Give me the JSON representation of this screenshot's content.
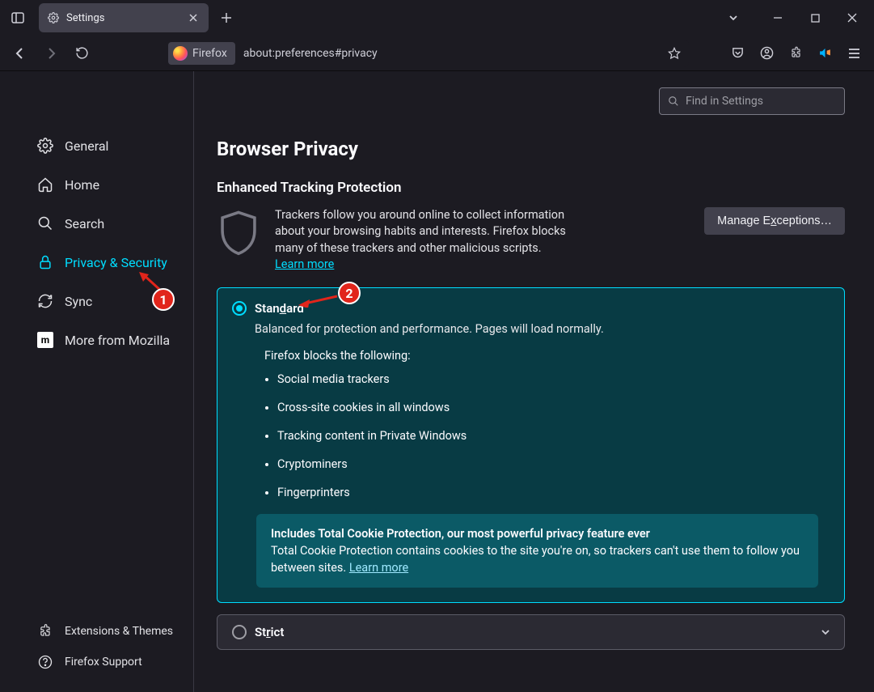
{
  "tab": {
    "title": "Settings"
  },
  "urlbar": {
    "identity": "Firefox",
    "url": "about:preferences#privacy"
  },
  "find": {
    "placeholder": "Find in Settings"
  },
  "nav": {
    "general": "General",
    "home": "Home",
    "search": "Search",
    "privacy": "Privacy & Security",
    "sync": "Sync",
    "mozilla": "More from Mozilla",
    "extensions": "Extensions & Themes",
    "support": "Firefox Support"
  },
  "page": {
    "heading": "Browser Privacy",
    "etp_heading": "Enhanced Tracking Protection",
    "etp_desc": "Trackers follow you around online to collect information about your browsing habits and interests. Firefox blocks many of these trackers and other malicious scripts.",
    "learn_more": "Learn more",
    "manage_exceptions": "Manage Exceptions…"
  },
  "standard": {
    "label_pre": "Stan",
    "label_u": "d",
    "label_post": "ard",
    "desc": "Balanced for protection and performance. Pages will load normally.",
    "blocks_intro": "Firefox blocks the following:",
    "items": [
      "Social media trackers",
      "Cross-site cookies in all windows",
      "Tracking content in Private Windows",
      "Cryptominers",
      "Fingerprinters"
    ],
    "tcp_head": "Includes Total Cookie Protection, our most powerful privacy feature ever",
    "tcp_body": "Total Cookie Protection contains cookies to the site you're on, so trackers can't use them to follow you between sites. ",
    "tcp_link": "Learn more"
  },
  "strict": {
    "label_pre": "St",
    "label_u": "r",
    "label_post": "ict"
  },
  "annotations": {
    "one": "1",
    "two": "2"
  }
}
